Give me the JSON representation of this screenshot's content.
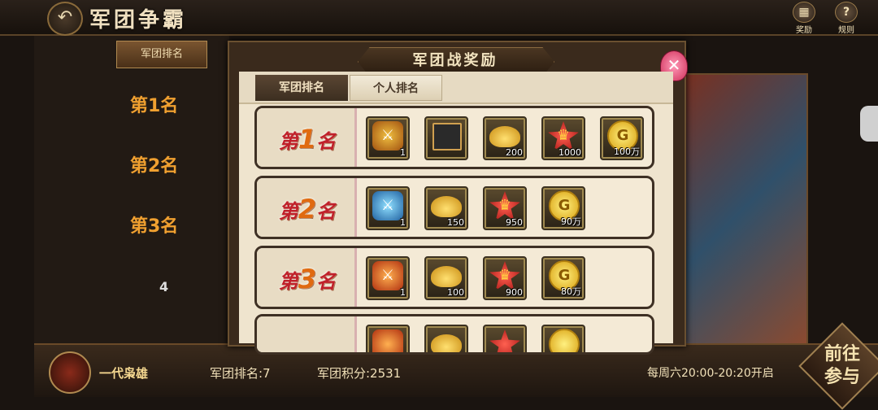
{
  "header": {
    "title": "军团争霸",
    "back_icon": "↶",
    "reward_label": "奖励",
    "rules_label": "规则",
    "reward_icon": "▦",
    "rules_icon": "?"
  },
  "background": {
    "tab_label": "军团排名",
    "ranks": [
      "第1名",
      "第2名",
      "第3名",
      "4"
    ],
    "guild_name": "一代枭雄",
    "guild_rank": "军团排名:7",
    "guild_score": "军团积分:2531",
    "schedule": "每周六20:00-20:20开启",
    "go_button": "前往参与"
  },
  "modal": {
    "title": "军团战奖励",
    "close_icon": "✕",
    "tabs": [
      {
        "label": "军团排名",
        "active": true
      },
      {
        "label": "个人排名",
        "active": false
      }
    ],
    "rows": [
      {
        "prefix": "第",
        "rank": "1",
        "suffix": "名",
        "items": [
          {
            "type": "weapon",
            "glyph": "⚔",
            "count": "1"
          },
          {
            "type": "frame",
            "glyph": "",
            "count": ""
          },
          {
            "type": "ingot",
            "glyph": "",
            "count": "200"
          },
          {
            "type": "star",
            "glyph": "♛",
            "count": "1000"
          },
          {
            "type": "coin",
            "glyph": "G",
            "count": "100万"
          }
        ]
      },
      {
        "prefix": "第",
        "rank": "2",
        "suffix": "名",
        "items": [
          {
            "type": "sword",
            "glyph": "⚔",
            "count": "1"
          },
          {
            "type": "ingot",
            "glyph": "",
            "count": "150"
          },
          {
            "type": "star",
            "glyph": "♛",
            "count": "950"
          },
          {
            "type": "coin",
            "glyph": "G",
            "count": "90万"
          }
        ]
      },
      {
        "prefix": "第",
        "rank": "3",
        "suffix": "名",
        "items": [
          {
            "type": "fire",
            "glyph": "⚔",
            "count": "1"
          },
          {
            "type": "ingot",
            "glyph": "",
            "count": "100"
          },
          {
            "type": "star",
            "glyph": "♛",
            "count": "900"
          },
          {
            "type": "coin",
            "glyph": "G",
            "count": "80万"
          }
        ]
      }
    ]
  }
}
